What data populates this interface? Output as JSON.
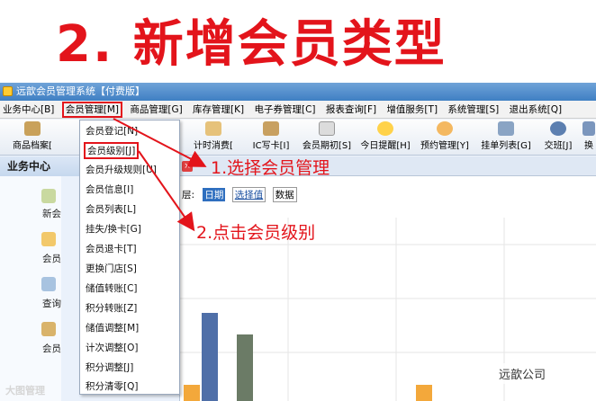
{
  "banner": {
    "title": "2. 新增会员类型"
  },
  "window": {
    "title": "远歆会员管理系统【付费版】"
  },
  "menubar": [
    {
      "label": "业务中心[B]"
    },
    {
      "label": "会员管理[M]"
    },
    {
      "label": "商品管理[G]"
    },
    {
      "label": "库存管理[K]"
    },
    {
      "label": "电子券管理[C]"
    },
    {
      "label": "报表查询[F]"
    },
    {
      "label": "增值服务[T]"
    },
    {
      "label": "系统管理[S]"
    },
    {
      "label": "退出系统[Q]"
    }
  ],
  "toolbar": [
    {
      "label": "商品档案[",
      "icon": "product-icon"
    },
    {
      "label": "计时消费[",
      "icon": "hourglass-icon"
    },
    {
      "label": "IC写卡[I]",
      "icon": "card-icon"
    },
    {
      "label": "会员期初[S]",
      "icon": "calendar-icon"
    },
    {
      "label": "今日提醒[H]",
      "icon": "bell-icon"
    },
    {
      "label": "预约管理[Y]",
      "icon": "clock-icon"
    },
    {
      "label": "挂单列表[G]",
      "icon": "cart-icon"
    },
    {
      "label": "交班[J]",
      "icon": "user-icon"
    },
    {
      "label": "换",
      "icon": "swap-icon"
    }
  ],
  "left": {
    "header": "业务中心",
    "items": [
      {
        "label": "新会"
      },
      {
        "label": "会员"
      },
      {
        "label": "查询"
      },
      {
        "label": "会员"
      }
    ]
  },
  "filters": {
    "prefix": "层:",
    "date": "日期",
    "select": "选择值",
    "data": "数据"
  },
  "dropdown": [
    {
      "label": "会员登记[N]"
    },
    {
      "label": "会员级别[J]"
    },
    {
      "label": "会员升级规则[U]"
    },
    {
      "label": "会员信息[I]"
    },
    {
      "label": "会员列表[L]"
    },
    {
      "label": "挂失/换卡[G]"
    },
    {
      "label": "会员退卡[T]"
    },
    {
      "label": "更换门店[S]"
    },
    {
      "label": "储值转账[C]"
    },
    {
      "label": "积分转账[Z]"
    },
    {
      "label": "储值调整[M]"
    },
    {
      "label": "计次调整[O]"
    },
    {
      "label": "积分调整[J]"
    },
    {
      "label": "积分清零[Q]"
    }
  ],
  "annotations": {
    "step1": "1.选择会员管理",
    "step2": "2.点击会员级别"
  },
  "watermarks": {
    "left": "大图管理",
    "right": "远歆公司"
  },
  "colors": {
    "accent": "#e3141b",
    "bar_blue": "#4f6fa8",
    "bar_green": "#6b7b66",
    "bar_orange": "#f3a83b"
  }
}
